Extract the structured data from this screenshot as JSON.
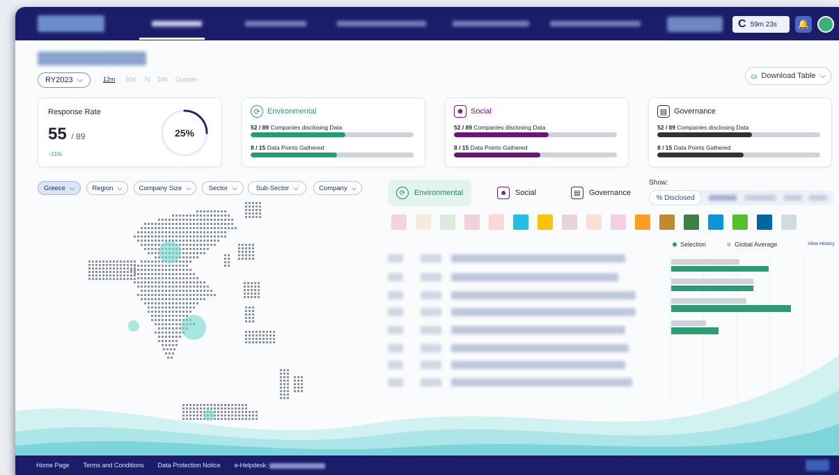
{
  "header": {
    "timer": "59m 23s",
    "timer_icon": "refresh-icon",
    "colors": {
      "navbar": "#1b1d6b",
      "accent": "#4a64c9"
    }
  },
  "period": {
    "reporting_year": "RY2023",
    "options": [
      "12m",
      "30d",
      "7d",
      "24h",
      "Custom"
    ],
    "active": "12m"
  },
  "toolbar": {
    "download_label": "Download Table"
  },
  "response_rate": {
    "title": "Response Rate",
    "value": "55",
    "total": "/ 89",
    "delta": "↑21%",
    "percent_label": "25%",
    "percent": 25
  },
  "cards": {
    "environmental": {
      "title": "Environmental",
      "companies_num": "52 / 89",
      "companies_text": " Companies disclosing Data",
      "points_num": "8 / 15",
      "points_text": " Data Points Gathered",
      "companies_fraction": 0.58,
      "points_fraction": 0.53,
      "color": "#1f9d74"
    },
    "social": {
      "title": "Social",
      "companies_num": "52 / 89",
      "companies_text": " Companies disclosing Data",
      "points_num": "8 / 15",
      "points_text": " Data Points Gathered",
      "companies_fraction": 0.58,
      "points_fraction": 0.53,
      "color": "#6b1479"
    },
    "governance": {
      "title": "Governance",
      "companies_num": "52 / 89",
      "companies_text": " Companies disclosing Data",
      "points_num": "8 / 15",
      "points_text": " Data Points Gathered",
      "companies_fraction": 0.58,
      "points_fraction": 0.53,
      "color": "#333333"
    }
  },
  "filters": {
    "country": "Greece",
    "region": "Region",
    "company_size": "Company Size",
    "sector": "Sector",
    "sub_sector": "Sub-Sector",
    "company": "Company"
  },
  "tabs": {
    "environmental": "Environmental",
    "social": "Social",
    "governance": "Governance"
  },
  "show": {
    "label": "Show:",
    "selected": "% Disclosed"
  },
  "sdg_colors": [
    "#e5243b",
    "#dda63a",
    "#4c9f38",
    "#c5192d",
    "#ff3a21",
    "#26bde2",
    "#fcc30b",
    "#a21942",
    "#fd6925",
    "#dd1367",
    "#fd9d24",
    "#bf8b2e",
    "#3f7e44",
    "#0a97d9",
    "#56c02b",
    "#00689d",
    "#19486a"
  ],
  "legend": {
    "selection": "Selection",
    "global_average": "Global Average",
    "view_history": "View History"
  },
  "footer": {
    "home": "Home Page",
    "terms": "Terms and Conditions",
    "privacy": "Data Protection Notice",
    "helpdesk": "e-Helpdesk:"
  }
}
